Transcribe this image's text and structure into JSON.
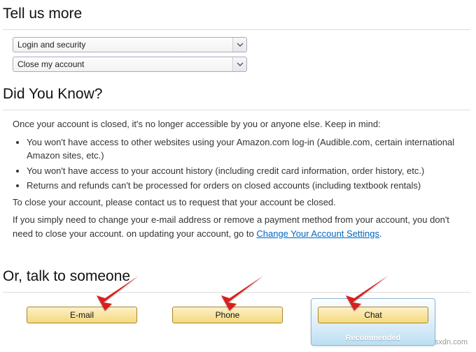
{
  "sections": {
    "tell_us_more": {
      "title": "Tell us more",
      "dropdown1": {
        "selected": "Login and security"
      },
      "dropdown2": {
        "selected": "Close my account"
      }
    },
    "did_you_know": {
      "title": "Did You Know?",
      "intro": "Once your account is closed, it's no longer accessible by you or anyone else. Keep in mind:",
      "bullets": [
        "You won't have access to other websites using your Amazon.com log-in (Audible.com, certain international Amazon sites, etc.)",
        "You won't have access to your account history (including credit card information, order history, etc.)",
        "Returns and refunds can't be processed for orders on closed accounts (including textbook rentals)"
      ],
      "close_line": "To close your account, please contact us to request that your account be closed.",
      "alt_line_part1": "If you simply need to change your e-mail address or remove a payment method from your account, you don't need to close your account. on updating your account, go to ",
      "alt_link": "Change Your Account Settings",
      "period": "."
    },
    "talk": {
      "title": "Or, talk to someone",
      "email": "E-mail",
      "phone": "Phone",
      "chat": "Chat",
      "recommended": "Recommended"
    }
  },
  "watermark": "wsxdn.com"
}
